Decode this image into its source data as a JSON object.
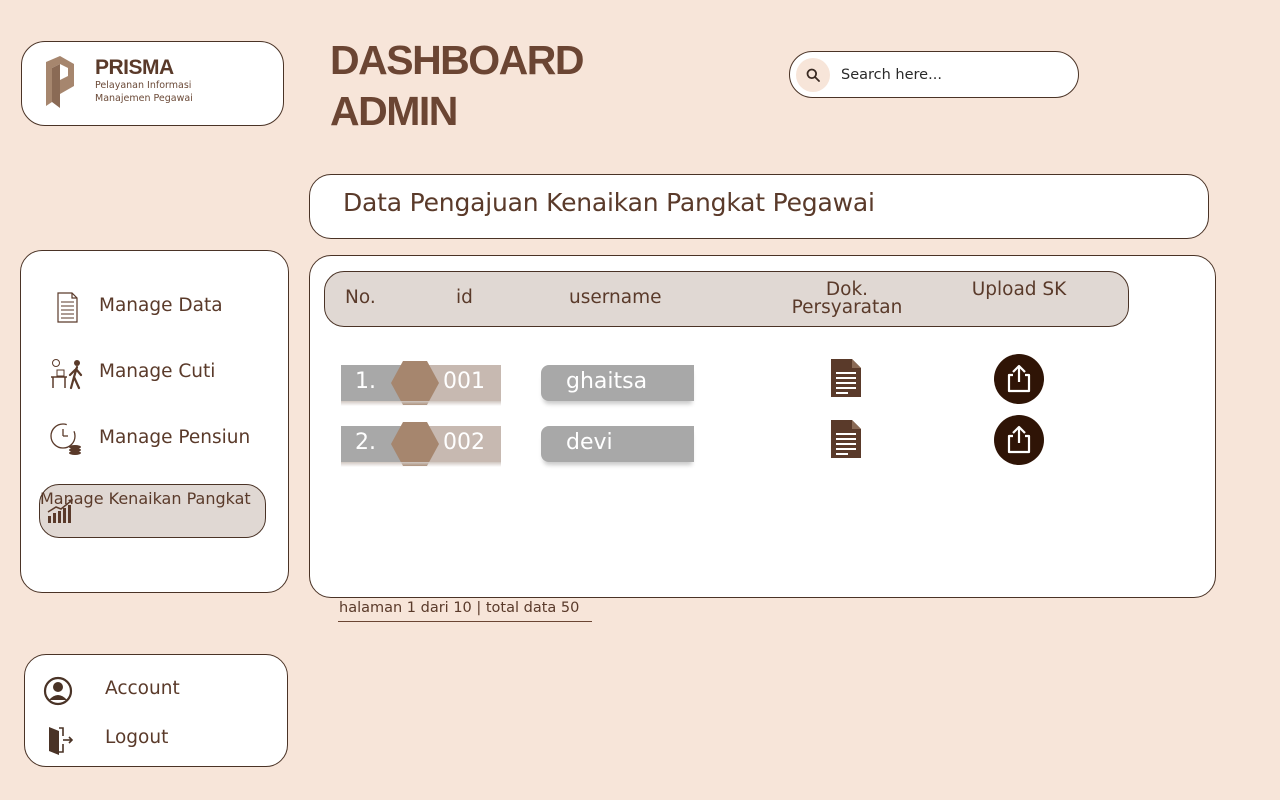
{
  "brand": {
    "name": "PRISMA",
    "subtitle_line1": "Pelayanan Informasi",
    "subtitle_line2": "Manajemen Pegawai"
  },
  "header": {
    "title_line1": "DASHBOARD",
    "title_line2": "ADMIN"
  },
  "search": {
    "placeholder": "Search here...",
    "icon": "search-icon"
  },
  "page": {
    "title": "Data Pengajuan Kenaikan Pangkat Pegawai"
  },
  "sidebar": {
    "items": [
      {
        "label": "Manage Data",
        "icon": "document-list-icon",
        "active": false
      },
      {
        "label": "Manage Cuti",
        "icon": "leave-walking-icon",
        "active": false
      },
      {
        "label": "Manage Pensiun",
        "icon": "clock-coins-icon",
        "active": false
      },
      {
        "label": "Manage Kenaikan Pangkat",
        "icon": "growth-chart-icon",
        "active": true
      }
    ]
  },
  "table": {
    "columns": [
      "No.",
      "id",
      "username",
      "Dok. Persyaratan",
      "Upload SK"
    ],
    "rows": [
      {
        "no": "1.",
        "id": "001",
        "username": "ghaitsa",
        "doc_icon": "document-icon",
        "upload_icon": "upload-icon"
      },
      {
        "no": "2.",
        "id": "002",
        "username": "devi",
        "doc_icon": "document-icon",
        "upload_icon": "upload-icon"
      }
    ]
  },
  "pagination": {
    "text": "halaman 1 dari 10 | total data 50"
  },
  "account_menu": {
    "items": [
      {
        "label": "Account",
        "icon": "user-circle-icon"
      },
      {
        "label": "Logout",
        "icon": "logout-door-icon"
      }
    ]
  },
  "colors": {
    "background": "#f7e5d9",
    "primary_text": "#5a3a2a",
    "accent_dark": "#2f1406",
    "highlight": "#e0d8d3"
  }
}
